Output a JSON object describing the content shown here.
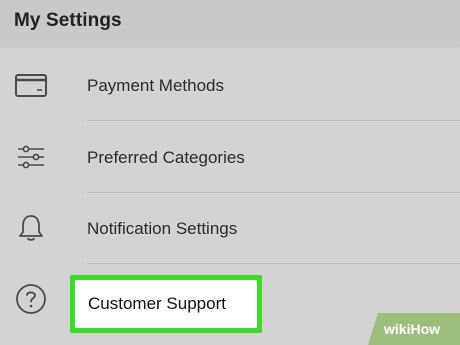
{
  "header": {
    "title": "My Settings"
  },
  "settings": {
    "items": [
      {
        "label": "Payment Methods",
        "icon": "credit-card-icon"
      },
      {
        "label": "Preferred Categories",
        "icon": "sliders-icon"
      },
      {
        "label": "Notification Settings",
        "icon": "bell-icon"
      },
      {
        "label": "Customer Support",
        "icon": "question-circle-icon",
        "highlighted": true
      }
    ]
  },
  "watermark": {
    "wiki": "wiki",
    "how": "How"
  },
  "colors": {
    "background": "#d3d3d3",
    "header_background": "#c9c9c9",
    "highlight_border": "#3bdc28",
    "highlight_fill": "#ffffff",
    "watermark_green": "#93b86d"
  }
}
